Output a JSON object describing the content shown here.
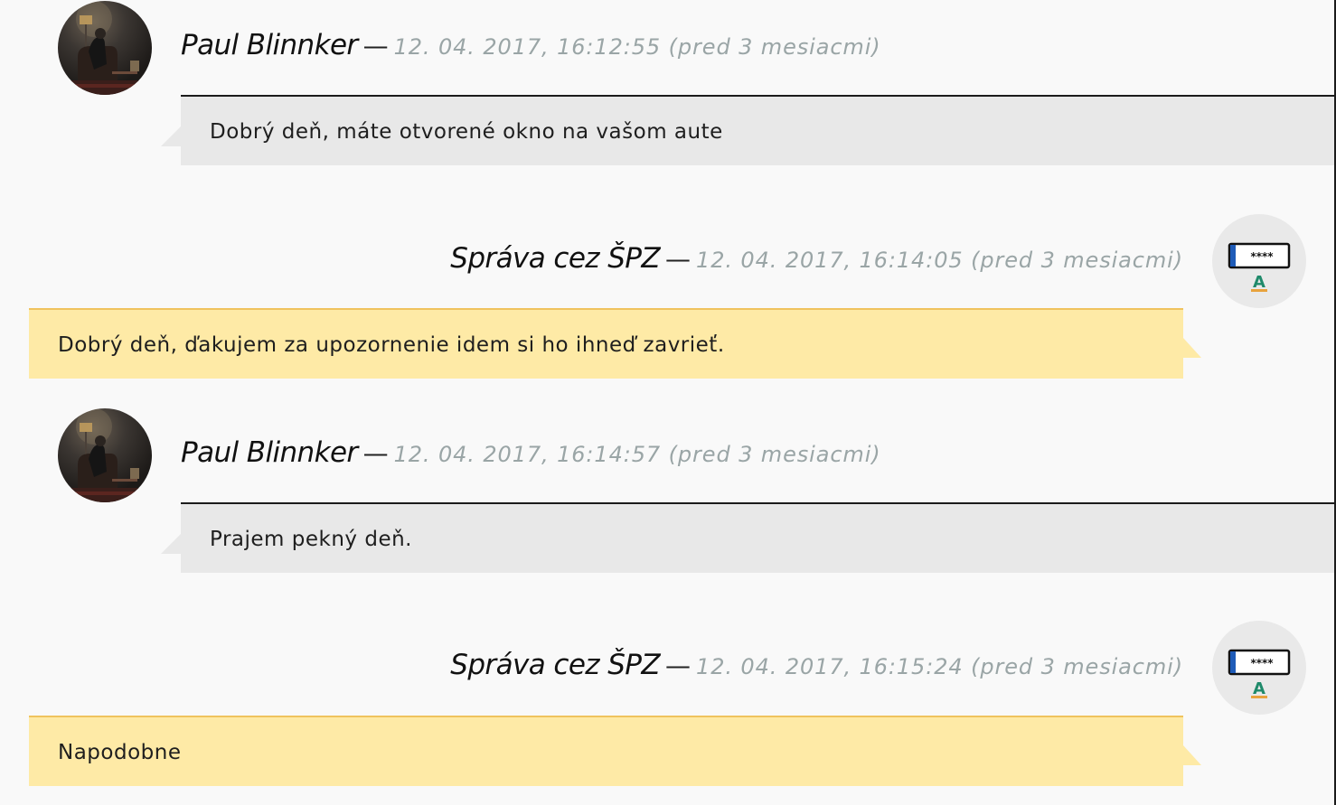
{
  "colors": {
    "page_background": "#f9f9f9",
    "incoming_bubble": "#e8e8e8",
    "outgoing_bubble": "#feeaa6",
    "outgoing_border": "#f0c35e",
    "timestamp_text": "#9aa5a6",
    "plate_blue": "#1e5bb8",
    "plate_letter_green": "#1f8a6a",
    "plate_letter_underline": "#e8a33d"
  },
  "messages": [
    {
      "direction": "incoming",
      "author": "Paul Blinnker",
      "separator": "—",
      "timestamp": "12. 04. 2017, 16:12:55 (pred 3 mesiacmi)",
      "text": "Dobrý deň, máte otvorené okno na vašom aute",
      "avatar_icon": "user-photo-avatar"
    },
    {
      "direction": "outgoing",
      "author": "Správa cez ŠPZ",
      "separator": "—",
      "timestamp": "12. 04. 2017, 16:14:05 (pred 3 mesiacmi)",
      "text": "Dobrý deň, ďakujem za upozornenie idem si ho ihneď zavrieť.",
      "avatar_icon": "license-plate-icon",
      "plate_mask": "****",
      "plate_letter": "A"
    },
    {
      "direction": "incoming",
      "author": "Paul Blinnker",
      "separator": "—",
      "timestamp": "12. 04. 2017, 16:14:57 (pred 3 mesiacmi)",
      "text": "Prajem pekný deň.",
      "avatar_icon": "user-photo-avatar"
    },
    {
      "direction": "outgoing",
      "author": "Správa cez ŠPZ",
      "separator": "—",
      "timestamp": "12. 04. 2017, 16:15:24 (pred 3 mesiacmi)",
      "text": "Napodobne",
      "avatar_icon": "license-plate-icon",
      "plate_mask": "****",
      "plate_letter": "A"
    }
  ]
}
